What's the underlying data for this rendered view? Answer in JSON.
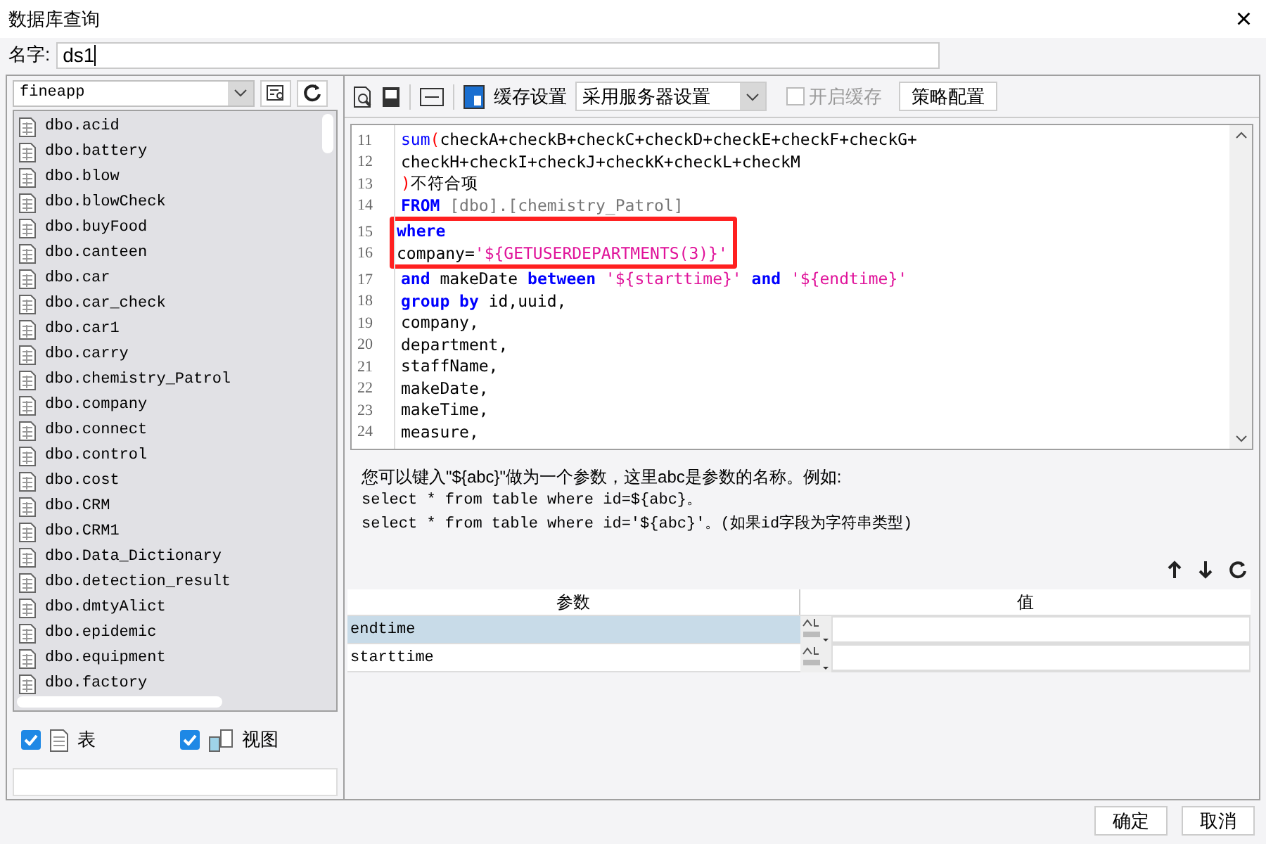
{
  "window": {
    "title": "数据库查询",
    "close": "×"
  },
  "name_field": {
    "label": "名字:",
    "value": "ds1"
  },
  "connection": {
    "value": "fineapp"
  },
  "tables": [
    {
      "label": "dbo.acid"
    },
    {
      "label": "dbo.battery"
    },
    {
      "label": "dbo.blow"
    },
    {
      "label": "dbo.blowCheck"
    },
    {
      "label": "dbo.buyFood"
    },
    {
      "label": "dbo.canteen"
    },
    {
      "label": "dbo.car"
    },
    {
      "label": "dbo.car_check"
    },
    {
      "label": "dbo.car1"
    },
    {
      "label": "dbo.carry"
    },
    {
      "label": "dbo.chemistry_Patrol"
    },
    {
      "label": "dbo.company"
    },
    {
      "label": "dbo.connect"
    },
    {
      "label": "dbo.control"
    },
    {
      "label": "dbo.cost"
    },
    {
      "label": "dbo.CRM"
    },
    {
      "label": "dbo.CRM1"
    },
    {
      "label": "dbo.Data_Dictionary"
    },
    {
      "label": "dbo.detection_result"
    },
    {
      "label": "dbo.dmtyAlict"
    },
    {
      "label": "dbo.epidemic"
    },
    {
      "label": "dbo.equipment"
    },
    {
      "label": "dbo.factory"
    }
  ],
  "filters": [
    {
      "label": "表",
      "checked": true,
      "kind": "table"
    },
    {
      "label": "视图",
      "checked": true,
      "kind": "view"
    }
  ],
  "toolbar": {
    "cache_label": "缓存设置",
    "cache_select": "采用服务器设置",
    "enable_cache": {
      "label": "开启缓存",
      "checked": false,
      "disabled": true
    },
    "strategy_button": "策略配置"
  },
  "code": [
    {
      "number": "11",
      "highlighted": false,
      "tokens": [
        {
          "text": "sum",
          "kind": "fn"
        },
        {
          "text": "(",
          "kind": "paren"
        },
        {
          "text": "checkA+checkB+checkC+checkD+checkE+checkF+checkG+",
          "kind": "plain"
        }
      ]
    },
    {
      "number": "12",
      "highlighted": false,
      "tokens": [
        {
          "text": "checkH+checkI+checkJ+checkK+checkL+checkM",
          "kind": "plain"
        }
      ]
    },
    {
      "number": "13",
      "highlighted": false,
      "tokens": [
        {
          "text": ")",
          "kind": "paren"
        },
        {
          "text": "不符合项",
          "kind": "plain"
        }
      ]
    },
    {
      "number": "14",
      "highlighted": false,
      "tokens": [
        {
          "text": "FROM",
          "kind": "keyword"
        },
        {
          "text": " [dbo].[chemistry_Patrol]",
          "kind": "ident"
        }
      ]
    },
    {
      "number": "15",
      "highlighted": true,
      "tokens": [
        {
          "text": "where",
          "kind": "keyword"
        }
      ]
    },
    {
      "number": "16",
      "highlighted": true,
      "tokens": [
        {
          "text": "company=",
          "kind": "plain"
        },
        {
          "text": "'${GETUSERDEPARTMENTS(3)}'",
          "kind": "string"
        }
      ]
    },
    {
      "number": "17",
      "highlighted": false,
      "tokens": [
        {
          "text": "and",
          "kind": "keyword"
        },
        {
          "text": " makeDate ",
          "kind": "plain"
        },
        {
          "text": "between",
          "kind": "keyword"
        },
        {
          "text": " '${starttime}' ",
          "kind": "string"
        },
        {
          "text": "and",
          "kind": "keyword"
        },
        {
          "text": " '${endtime}'",
          "kind": "string"
        }
      ]
    },
    {
      "number": "18",
      "highlighted": false,
      "tokens": [
        {
          "text": "group by",
          "kind": "keyword"
        },
        {
          "text": " id,uuid,",
          "kind": "plain"
        }
      ]
    },
    {
      "number": "19",
      "highlighted": false,
      "tokens": [
        {
          "text": "company,",
          "kind": "plain"
        }
      ]
    },
    {
      "number": "20",
      "highlighted": false,
      "tokens": [
        {
          "text": "department,",
          "kind": "plain"
        }
      ]
    },
    {
      "number": "21",
      "highlighted": false,
      "tokens": [
        {
          "text": "staffName,",
          "kind": "plain"
        }
      ]
    },
    {
      "number": "22",
      "highlighted": false,
      "tokens": [
        {
          "text": "makeDate,",
          "kind": "plain"
        }
      ]
    },
    {
      "number": "23",
      "highlighted": false,
      "tokens": [
        {
          "text": "makeTime,",
          "kind": "plain"
        }
      ]
    },
    {
      "number": "24",
      "highlighted": false,
      "tokens": [
        {
          "text": "measure,",
          "kind": "plain"
        }
      ]
    }
  ],
  "hint": {
    "intro": "您可以键入\"${abc}\"做为一个参数，这里abc是参数的名称。例如:",
    "examples": [
      "select * from table where id=${abc}。",
      "select * from table where id='${abc}'。(如果id字段为字符串类型)"
    ]
  },
  "params": {
    "columns": [
      "参数",
      "值"
    ],
    "rows": [
      {
        "name": "endtime",
        "selected": true
      },
      {
        "name": "starttime",
        "selected": false
      }
    ]
  },
  "buttons": [
    "确定",
    "取消"
  ]
}
